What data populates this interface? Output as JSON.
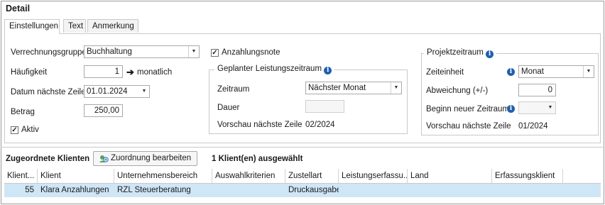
{
  "detail_title": "Detail",
  "tabs": [
    "Einstellungen",
    "Text",
    "Anmerkung"
  ],
  "left": {
    "verrechnungsgruppe_label": "Verrechnungsgruppe",
    "verrechnungsgruppe_value": "Buchhaltung",
    "haeufigkeit_label": "Häufigkeit",
    "haeufigkeit_value": "1",
    "haeufigkeit_unit": "monatlich",
    "datum_label": "Datum nächste Zeile",
    "datum_value": "01.01.2024",
    "betrag_label": "Betrag",
    "betrag_value": "250,00",
    "aktiv_label": "Aktiv",
    "aktiv_checked": true
  },
  "middle": {
    "anzahlungsnote_label": "Anzahlungsnote",
    "anzahlungsnote_checked": true,
    "group_title": "Geplanter Leistungszeitraum",
    "zeitraum_label": "Zeitraum",
    "zeitraum_value": "Nächster Monat",
    "dauer_label": "Dauer",
    "dauer_value": "",
    "vorschau_label": "Vorschau nächste Zeile",
    "vorschau_value": "02/2024"
  },
  "right": {
    "group_title": "Projektzeitraum",
    "zeiteinheit_label": "Zeiteinheit",
    "zeiteinheit_value": "Monat",
    "abweichung_label": "Abweichung (+/-)",
    "abweichung_value": "0",
    "beginn_label": "Beginn neuer Zeitraum",
    "beginn_value": "",
    "vorschau_label": "Vorschau nächste Zeile",
    "vorschau_value": "01/2024"
  },
  "clients": {
    "title": "Zugeordnete Klienten",
    "edit_button": "Zuordnung bearbeiten",
    "selected_count": "1 Klient(en) ausgewählt",
    "columns": [
      "Klient...",
      "Klient",
      "Unternehmensbereich",
      "Auswahlkriterien",
      "Zustellart",
      "Leistungserfassu...",
      "Land",
      "Erfassungsklient"
    ],
    "rows": [
      [
        "55",
        "Klara Anzahlungen",
        "RZL Steuerberatung",
        "",
        "Druckausgabe",
        "",
        "",
        ""
      ]
    ]
  },
  "colors": {
    "info_icon": "#1f5fae",
    "selected_row": "#cfe6f7",
    "border": "#c9c9c9"
  },
  "icons": {
    "info": "info-icon",
    "arrow": "arrow-right-icon",
    "dropdown": "chevron-down-icon",
    "checkbox": "check-icon",
    "edit": "edit-assignment-icon"
  }
}
